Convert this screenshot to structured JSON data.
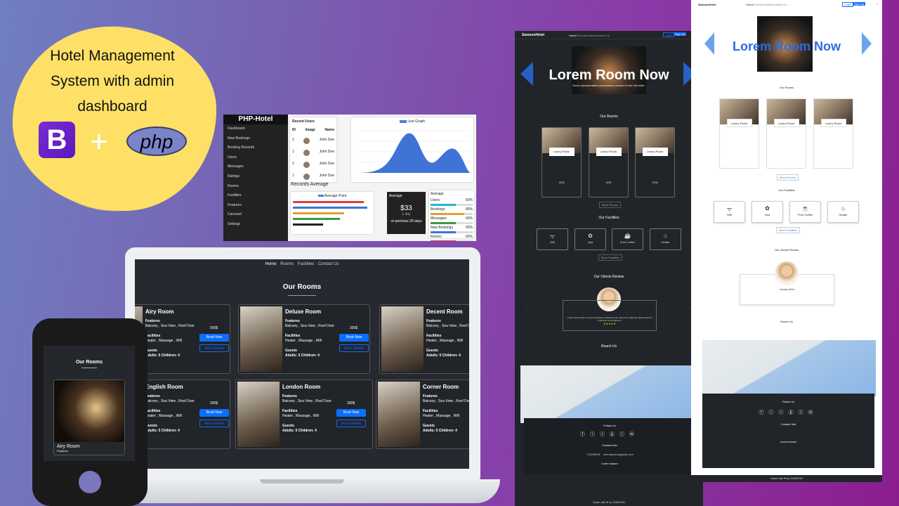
{
  "promo": {
    "title_lines": [
      "Hotel Management",
      "System with admin",
      "dashboard"
    ],
    "bootstrap_letter": "B",
    "plus": "+",
    "php": "php"
  },
  "admin": {
    "logo": "PHP-Hotel",
    "nav": [
      "Dashboard",
      "New Bookings",
      "Booking Records",
      "Users",
      "Messages",
      "Ratings",
      "Rooms",
      "Facilities",
      "Features",
      "Carousel",
      "Settings"
    ],
    "recent_users": {
      "title": "Recent Users",
      "headers": [
        "ID",
        "Image",
        "Name"
      ],
      "rows": [
        [
          "1",
          "John Doe"
        ],
        [
          "1",
          "John Doe"
        ],
        [
          "1",
          "John Doe"
        ],
        [
          "1",
          "John Doe"
        ]
      ]
    },
    "line_chart_legend": "Line Graph",
    "records_average_title": "Records Average",
    "bar_legend": "Average Point",
    "average_card": {
      "label": "Average",
      "value": "$33",
      "sub": "1 day",
      "note": "vs previous 30 days"
    },
    "average_list": {
      "title": "Average",
      "items": [
        [
          "Users",
          "60%"
        ],
        [
          "Bookings",
          "80%"
        ],
        [
          "Messages",
          "60%"
        ],
        [
          "New Bookings",
          "60%"
        ],
        [
          "Rooms",
          "60%"
        ]
      ]
    }
  },
  "laptop": {
    "nav": [
      "Home",
      "Rooms",
      "Facilities",
      "Contact Us"
    ],
    "section_title": "Our Rooms",
    "rooms": [
      {
        "name": "Airy Room",
        "price": "500$"
      },
      {
        "name": "Deluxe Room",
        "price": "300$"
      },
      {
        "name": "Decent Room",
        "price": ""
      },
      {
        "name": "English Room",
        "price": "300$"
      },
      {
        "name": "London Room",
        "price": "300$"
      },
      {
        "name": "Corner Room",
        "price": ""
      }
    ],
    "features_label": "Features",
    "features_value": "Balcony , Sea View , Roof Door",
    "facilities_label": "Facilities",
    "facilities_value": "Heater , Massage , Wifi",
    "guests_label": "Guests",
    "guests_value": "Adults: 5 Children: 4",
    "book_now": "Book Now",
    "more_details": "More Details"
  },
  "phone": {
    "title": "Our Rooms",
    "room_name": "Airy Room",
    "sub": "Features"
  },
  "dark_site": {
    "brand": "SamsonHotel",
    "nav": [
      "Home",
      "Rooms",
      "Facilities",
      "Contact Us"
    ],
    "login": "Login",
    "signup": "Sign Up",
    "hero": "Lorem Room Now",
    "hero_sub": "Some representative placeholder content for the first slide.",
    "our_rooms": "Our Rooms",
    "room_label": "Luxury Room",
    "room_price": "300$",
    "more_rooms": "More Rooms",
    "our_facilities": "Our Facilities",
    "facilities": [
      "Wifi",
      "Spa",
      "Free Coffee",
      "Heater"
    ],
    "more_facilities": "More Facilities",
    "reviews_title": "Our Clients Review",
    "review_text": "Lorem ipsum dolor sit amet consectetur adipisicing elit, sed do lor culpa qui officia deserunt mollit anim id est laborum.",
    "stars": "★★★★★",
    "reach_us": "Reach Us",
    "follow_us": "Follow Us",
    "contact_info": "Contact Info",
    "phone": "+12345678",
    "email": "loremipsum@gmail.com",
    "footer_heading": "Lorem Ipsum",
    "made_with": "Made with ♥ by SAMSON"
  },
  "light_site": {
    "brand": "SamsonHotel",
    "nav": [
      "Home",
      "Rooms",
      "Facilities",
      "Contact Us"
    ],
    "login": "Login",
    "signup": "Sign Up",
    "hero": "Lorem Room Now",
    "our_rooms": "Our Rooms",
    "room_label": "Luxury Room",
    "more_rooms": "More Rooms",
    "our_facilities": "Our Facilities",
    "facilities": [
      "Wifi",
      "Spa",
      "Free Coffee",
      "Heater"
    ],
    "more_facilities": "More Facilities",
    "reviews_title": "Our Clients Review",
    "reviewer": "Leona John",
    "reach_us": "Reach Us",
    "follow_us": "Follow Us",
    "contact_info": "Contact Info",
    "footer_heading": "Lorem Ipsum",
    "made_with": "Made with ♥ by SAMSON"
  },
  "colors": {
    "accent": "#0d6efd",
    "badge": "#ffe066",
    "dark_bg": "#212529"
  }
}
